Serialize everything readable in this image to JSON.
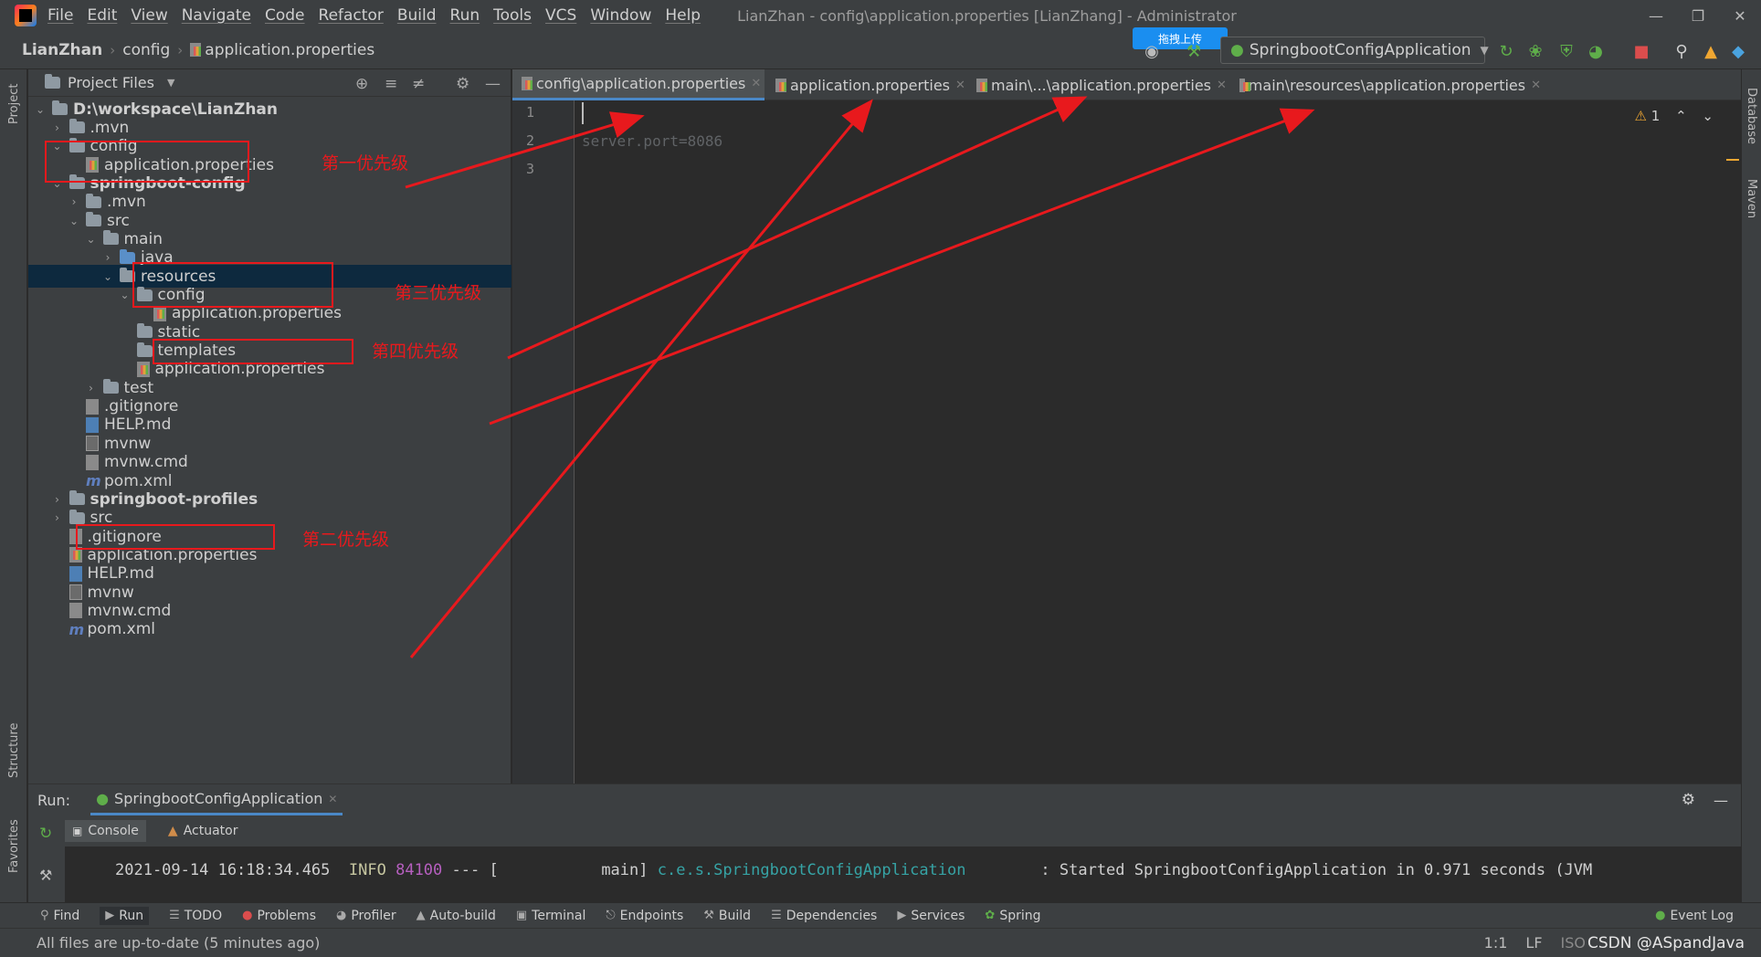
{
  "window": {
    "menus": [
      "File",
      "Edit",
      "View",
      "Navigate",
      "Code",
      "Refactor",
      "Build",
      "Run",
      "Tools",
      "VCS",
      "Window",
      "Help"
    ],
    "title": "LianZhan - config\\application.properties [LianZhang] - Administrator",
    "upload_label": "拖拽上传"
  },
  "breadcrumb": [
    "LianZhan",
    "config",
    "application.properties"
  ],
  "run_config": {
    "label": "SpringbootConfigApplication"
  },
  "left_stripe": {
    "project": "Project",
    "structure": "Structure",
    "favorites": "Favorites"
  },
  "right_stripe": {
    "database": "Database",
    "maven": "Maven"
  },
  "project_panel": {
    "header": "Project Files",
    "tree": [
      {
        "label": "D:\\workspace\\LianZhan",
        "kind": "folder",
        "depth": 0,
        "expanded": true,
        "bold": true
      },
      {
        "label": ".mvn",
        "kind": "folder",
        "depth": 1,
        "expanded": false
      },
      {
        "label": "config",
        "kind": "folder",
        "depth": 1,
        "expanded": true
      },
      {
        "label": "application.properties",
        "kind": "props",
        "depth": 2
      },
      {
        "label": "springboot-config",
        "kind": "folder",
        "depth": 1,
        "expanded": true,
        "bold": true
      },
      {
        "label": ".mvn",
        "kind": "folder",
        "depth": 2,
        "expanded": false
      },
      {
        "label": "src",
        "kind": "folder",
        "depth": 2,
        "expanded": true
      },
      {
        "label": "main",
        "kind": "folder",
        "depth": 3,
        "expanded": true
      },
      {
        "label": "java",
        "kind": "src",
        "depth": 4,
        "expanded": false
      },
      {
        "label": "resources",
        "kind": "res",
        "depth": 4,
        "expanded": true,
        "selected": true
      },
      {
        "label": "config",
        "kind": "folder",
        "depth": 5,
        "expanded": true
      },
      {
        "label": "application.properties",
        "kind": "props",
        "depth": 6
      },
      {
        "label": "static",
        "kind": "folder",
        "depth": 5
      },
      {
        "label": "templates",
        "kind": "folder",
        "depth": 5
      },
      {
        "label": "application.properties",
        "kind": "props",
        "depth": 5
      },
      {
        "label": "test",
        "kind": "folder",
        "depth": 3,
        "expanded": false
      },
      {
        "label": ".gitignore",
        "kind": "plain",
        "depth": 2
      },
      {
        "label": "HELP.md",
        "kind": "md",
        "depth": 2
      },
      {
        "label": "mvnw",
        "kind": "cmd",
        "depth": 2
      },
      {
        "label": "mvnw.cmd",
        "kind": "plain",
        "depth": 2
      },
      {
        "label": "pom.xml",
        "kind": "maven",
        "depth": 2
      },
      {
        "label": "springboot-profiles",
        "kind": "folder",
        "depth": 1,
        "expanded": false,
        "bold": true
      },
      {
        "label": "src",
        "kind": "folder",
        "depth": 1,
        "expanded": false
      },
      {
        "label": ".gitignore",
        "kind": "plain",
        "depth": 1
      },
      {
        "label": "application.properties",
        "kind": "props",
        "depth": 1
      },
      {
        "label": "HELP.md",
        "kind": "md",
        "depth": 1
      },
      {
        "label": "mvnw",
        "kind": "cmd",
        "depth": 1
      },
      {
        "label": "mvnw.cmd",
        "kind": "plain",
        "depth": 1
      },
      {
        "label": "pom.xml",
        "kind": "maven",
        "depth": 1
      }
    ]
  },
  "annotations": {
    "first": "第一优先级",
    "second": "第二优先级",
    "third": "第三优先级",
    "fourth": "第四优先级",
    "color": "#e8191d"
  },
  "editor": {
    "tabs": [
      {
        "label": "config\\application.properties",
        "active": true
      },
      {
        "label": "application.properties",
        "active": false
      },
      {
        "label": "main\\...\\application.properties",
        "active": false
      },
      {
        "label": "main\\resources\\application.properties",
        "active": false
      }
    ],
    "line_numbers": [
      "1",
      "2",
      "3"
    ],
    "lines": [
      "",
      "server.port=8086",
      ""
    ],
    "warning_count": "1"
  },
  "run_panel": {
    "label": "Run:",
    "config_tab": "SpringbootConfigApplication",
    "subtabs": [
      "Console",
      "Actuator"
    ],
    "log": {
      "timestamp": "2021-09-14 16:18:34.465",
      "level": "INFO",
      "pid": "84100",
      "sep": "--- [",
      "thread": "main]",
      "logger": "c.e.s.SpringbootConfigApplication",
      "message": ": Started SpringbootConfigApplication in 0.971 seconds (JVM"
    }
  },
  "bottom_tools": [
    "Find",
    "Run",
    "TODO",
    "Problems",
    "Profiler",
    "Auto-build",
    "Terminal",
    "Endpoints",
    "Build",
    "Dependencies",
    "Services",
    "Spring"
  ],
  "event_log": "Event Log",
  "status": {
    "message": "All files are up-to-date (5 minutes ago)",
    "position": "1:1",
    "line_sep": "LF",
    "encoding": "ISO",
    "watermark": "CSDN @ASpandJava"
  }
}
